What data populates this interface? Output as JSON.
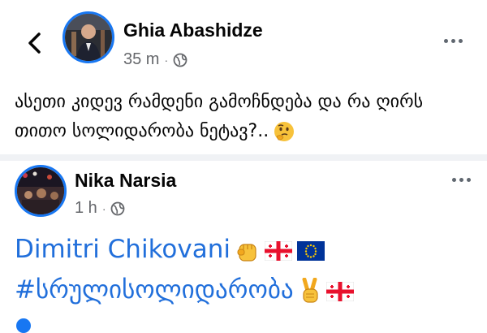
{
  "post1": {
    "author": "Ghia Abashidze",
    "time": "35 m",
    "dot": "·",
    "text_line1": "ასეთი კიდევ რამდენი გამოჩნდება და რა ღირს",
    "text_line2": "თითო სოლიდარობა ნეტავ?..",
    "emoji": "thinking-face"
  },
  "post2": {
    "author": "Nika Narsia",
    "time": "1 h",
    "dot": "·",
    "line1_text": "Dimitri Chikovani",
    "line2_text": "#სრულისოლიდარობა",
    "emojis": [
      "raised-fist",
      "georgia-flag",
      "eu-flag",
      "victory-hand",
      "georgia-flag"
    ]
  },
  "colors": {
    "accent": "#1877f2",
    "link": "#216fdb",
    "meta": "#65676b",
    "divider": "#f0f2f5"
  }
}
